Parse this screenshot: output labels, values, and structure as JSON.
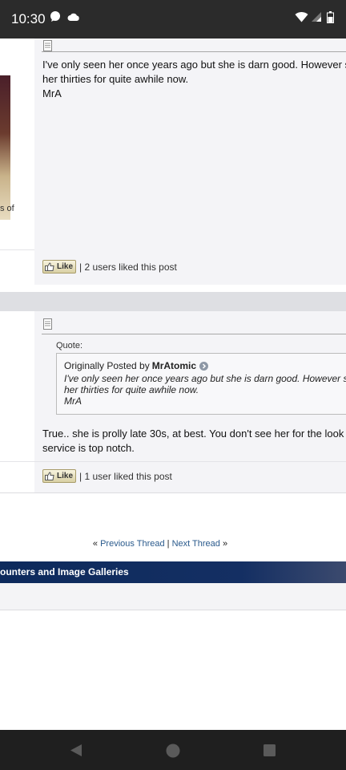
{
  "status_bar": {
    "time": "10:30"
  },
  "posts": [
    {
      "side_text": "s of",
      "message_lines": [
        "I've only seen her once years ago but she is darn good. However s",
        "her thirties for quite awhile now.",
        "MrA"
      ],
      "like_label": "Like",
      "likes_text": "| 2 users liked this post"
    },
    {
      "quote_label": "Quote:",
      "quote_prefix": "Originally Posted by",
      "quote_author": "MrAtomic",
      "quote_lines": [
        "I've only seen her once years ago but she is darn good. However she",
        "her thirties for quite awhile now.",
        "MrA"
      ],
      "message_lines": [
        "True.. she is prolly late 30s, at best. You don't see her for the look",
        "service is top notch."
      ],
      "like_label": "Like",
      "likes_text": "| 1 user liked this post"
    }
  ],
  "thread_nav": {
    "prefix": "«",
    "previous": "Previous Thread",
    "separator": "|",
    "next": "Next Thread",
    "suffix": "»"
  },
  "forum_bar": {
    "title": "ounters and Image Galleries"
  },
  "colors": {
    "status_bar": "#2b2b2b",
    "post_background": "#f4f4f7",
    "forum_bar": "#142f63",
    "link": "#2a5a8c"
  }
}
